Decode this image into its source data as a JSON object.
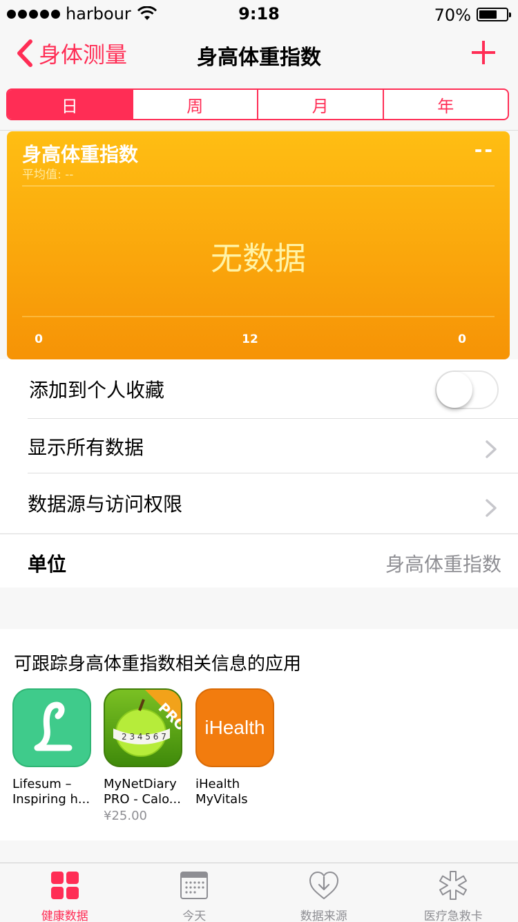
{
  "status_bar": {
    "carrier": "harbour",
    "time": "9:18",
    "battery": "70%",
    "battery_level": 0.7
  },
  "nav": {
    "back_label": "身体测量",
    "title": "身高体重指数",
    "add_icon": "plus-icon"
  },
  "segments": [
    {
      "label": "日",
      "active": true
    },
    {
      "label": "周",
      "active": false
    },
    {
      "label": "月",
      "active": false
    },
    {
      "label": "年",
      "active": false
    }
  ],
  "chart": {
    "title": "身高体重指数",
    "average": "平均值: --",
    "current_value": "--",
    "no_data": "无数据",
    "x_labels": [
      "0",
      "12",
      "0"
    ],
    "colors": {
      "top": "#ffbe13",
      "bottom": "#f69306"
    }
  },
  "list": {
    "favorite_label": "添加到个人收藏",
    "favorite_on": false,
    "show_all_label": "显示所有数据",
    "sources_label": "数据源与访问权限"
  },
  "unit": {
    "label": "单位",
    "value": "身高体重指数"
  },
  "apps": {
    "title": "可跟踪身高体重指数相关信息的应用",
    "items": [
      {
        "name_line1": "Lifesum –",
        "name_line2": "Inspiring h...",
        "price": "",
        "color": "#3fcb8b"
      },
      {
        "name_line1": "MyNetDiary",
        "name_line2": "PRO - Calo...",
        "price": "¥25.00",
        "color": "#5aa80d",
        "badge": "PRO"
      },
      {
        "name_line1": "iHealth",
        "name_line2": "MyVitals",
        "price": "",
        "color": "#f27c0e",
        "icon_text": "iHealth"
      }
    ]
  },
  "tabs": [
    {
      "label": "健康数据",
      "icon": "health-data-icon",
      "active": true
    },
    {
      "label": "今天",
      "icon": "calendar-icon",
      "active": false
    },
    {
      "label": "数据来源",
      "icon": "sources-icon",
      "active": false
    },
    {
      "label": "医疗急救卡",
      "icon": "medical-id-icon",
      "active": false
    }
  ],
  "colors": {
    "accent": "#ff2d55",
    "secondary_text": "#8e8e93"
  }
}
